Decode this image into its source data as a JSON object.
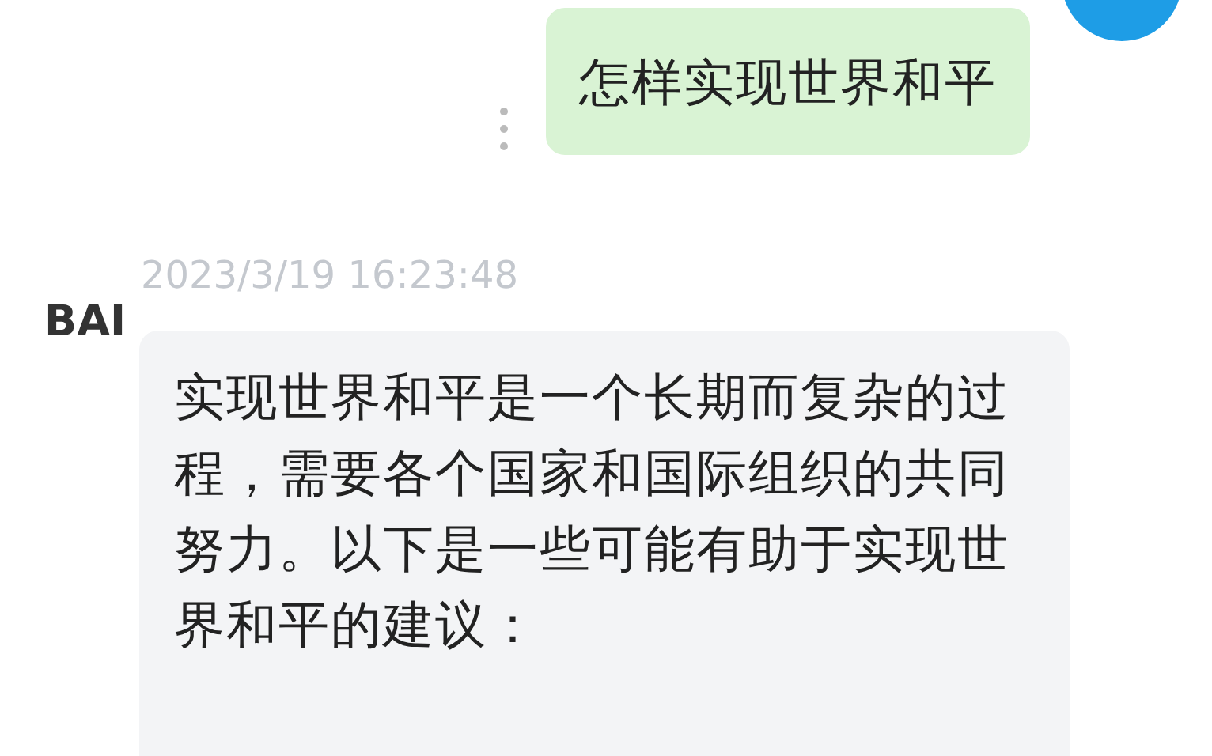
{
  "messages": [
    {
      "kind": "user",
      "text": "怎样实现世界和平"
    },
    {
      "kind": "bot",
      "sender": "BAI",
      "time": "2023/3/19 16:23:48",
      "text": "实现世界和平是一个长期而复杂的过程，需要各个国家和国际组织的共同努力。以下是一些可能有助于实现世界和平的建议："
    }
  ]
}
